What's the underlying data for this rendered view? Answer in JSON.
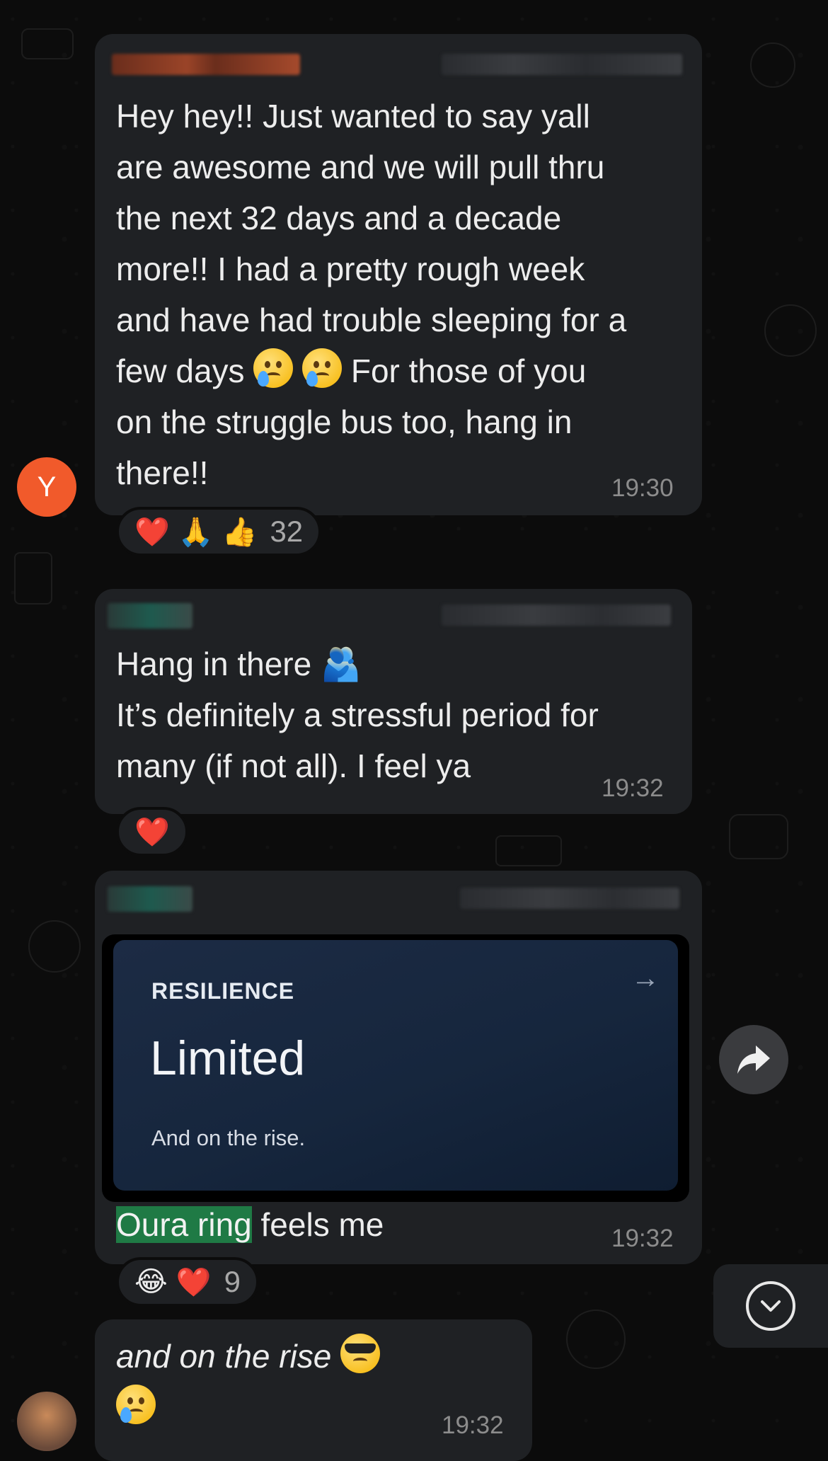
{
  "messages": [
    {
      "avatar_letter": "Y",
      "text_before_emoji": "Hey hey!! Just wanted to say yall\nare awesome and we will pull thru\nthe next 32 days and a decade\nmore!! I had a pretty rough week\nand have had trouble sleeping for a\nfew days ",
      "text_after_emoji": " For those of you\non the struggle bus too, hang in\nthere!!",
      "time": "19:30",
      "reactions": {
        "emojis": [
          "❤️",
          "🙏",
          "👍"
        ],
        "count": "32"
      }
    },
    {
      "line1": "Hang in there ",
      "line1_emoji": "🫂",
      "text": "It’s definitely a stressful period for\nmany (if not all). I feel ya",
      "time": "19:32",
      "reactions": {
        "emojis": [
          "❤️"
        ]
      }
    },
    {
      "card": {
        "label": "RESILIENCE",
        "value": "Limited",
        "subtitle": "And on the rise.",
        "arrow": "→"
      },
      "highlighted_text": "Oura ring",
      "rest_text": " feels me",
      "time": "19:32",
      "reactions": {
        "emojis": [
          "😂",
          "❤️"
        ],
        "count": "9"
      }
    },
    {
      "text": "and on the rise ",
      "time": "19:32"
    }
  ],
  "icons": {
    "forward": "forward-icon",
    "scroll_down": "chevron-down-icon"
  },
  "colors": {
    "bubble": "#1f2124",
    "avatar_y": "#f15a2b",
    "highlight": "#1f7a45",
    "card_bg": "#16263d"
  }
}
